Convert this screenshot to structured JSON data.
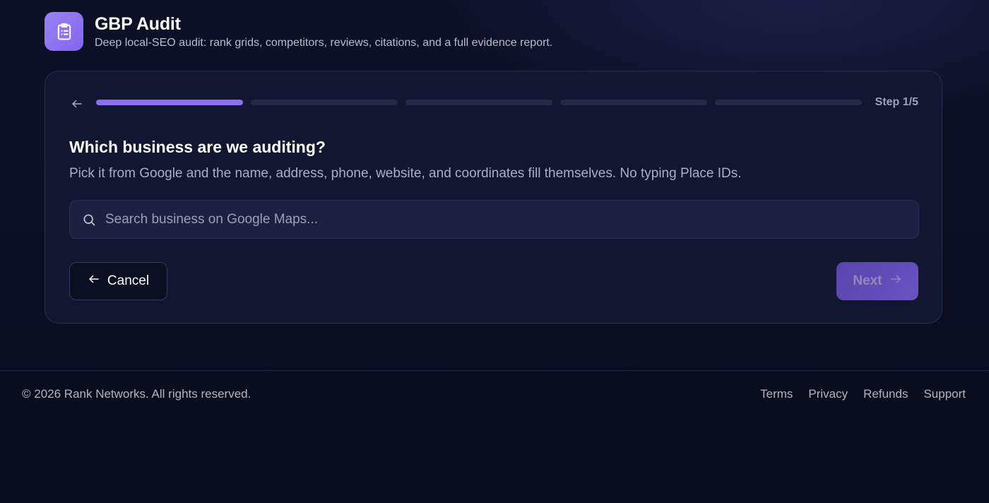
{
  "app": {
    "title": "GBP Audit",
    "subtitle": "Deep local-SEO audit: rank grids, competitors, reviews, citations, and a full evidence report.",
    "logo_icon": "clipboard-list-icon",
    "accent_color": "#8d6ff2"
  },
  "wizard": {
    "step_label": "Step 1/5",
    "current_step": 1,
    "total_steps": 5,
    "question": "Which business are we auditing?",
    "helper": "Pick it from Google and the name, address, phone, website, and coordinates fill themselves. No typing Place IDs.",
    "search": {
      "placeholder": "Search business on Google Maps...",
      "value": "",
      "icon": "search-icon"
    },
    "cancel_label": "Cancel",
    "next_label": "Next"
  },
  "footer": {
    "copyright": "© 2026 Rank Networks. All rights reserved.",
    "links": [
      {
        "label": "Terms"
      },
      {
        "label": "Privacy"
      },
      {
        "label": "Refunds"
      },
      {
        "label": "Support"
      }
    ]
  }
}
